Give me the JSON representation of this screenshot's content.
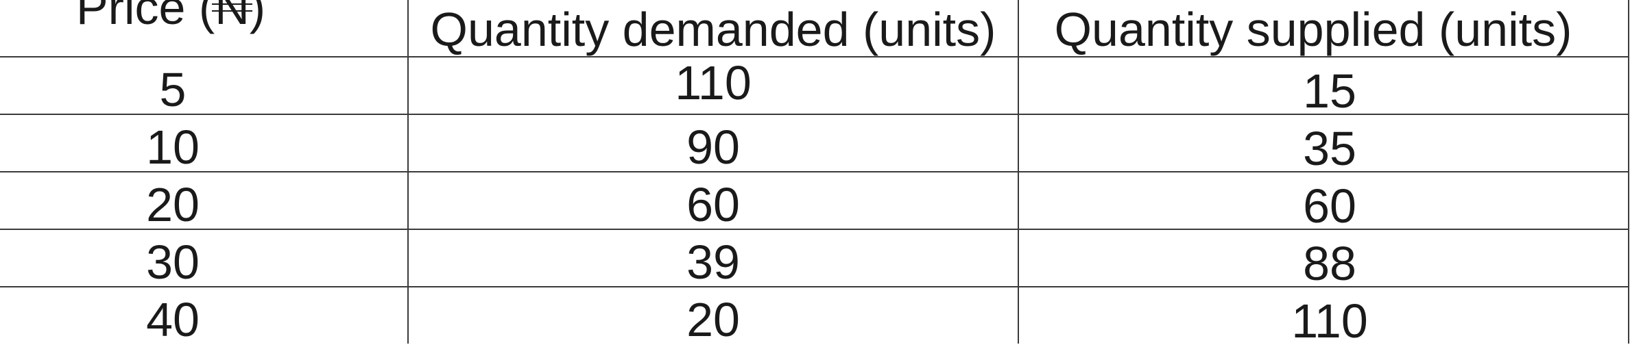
{
  "table": {
    "headers": {
      "price_prefix": "Price (",
      "price_currency_symbol": "N",
      "price_suffix": ")",
      "quantity_demanded": "Quantity demanded (units)",
      "quantity_supplied": "Quantity supplied (units)"
    },
    "rows": [
      {
        "price": "5",
        "quantity_demanded": "110",
        "quantity_supplied": "15"
      },
      {
        "price": "10",
        "quantity_demanded": "90",
        "quantity_supplied": "35"
      },
      {
        "price": "20",
        "quantity_demanded": "60",
        "quantity_supplied": "60"
      },
      {
        "price": "30",
        "quantity_demanded": "39",
        "quantity_supplied": "88"
      },
      {
        "price": "40",
        "quantity_demanded": "20",
        "quantity_supplied": "110"
      }
    ]
  },
  "colors": {
    "text": "#1a1a1a",
    "grid": "#3a3a3a",
    "background": "#ffffff"
  }
}
